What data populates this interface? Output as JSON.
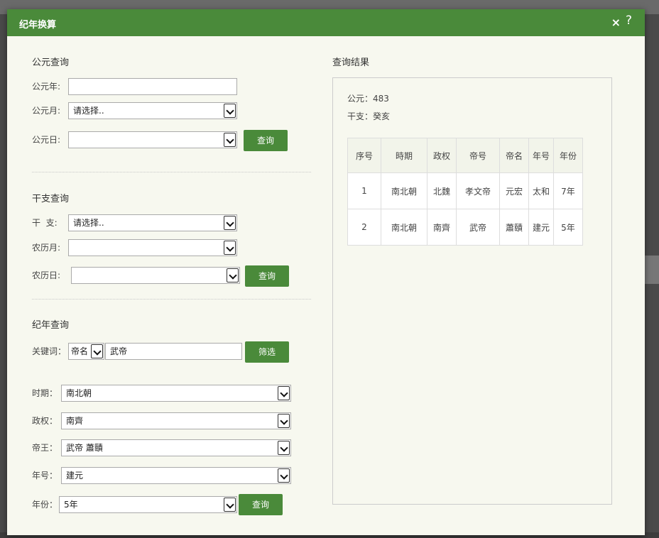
{
  "dialog": {
    "title": "纪年换算",
    "close_label": "×",
    "help_label": "?"
  },
  "ad_query": {
    "title": "公元查询",
    "year_label": "公元年:",
    "year_value": "",
    "month_label": "公元月:",
    "month_value": "请选择..",
    "day_label": "公元日:",
    "day_value": "",
    "submit_label": "查询"
  },
  "ganzhi_query": {
    "title": "干支查询",
    "ganzhi_label": "干  支:",
    "ganzhi_value": "请选择..",
    "lunar_month_label": "农历月:",
    "lunar_month_value": "",
    "lunar_day_label": "农历日:",
    "lunar_day_value": "",
    "submit_label": "查询"
  },
  "era_query": {
    "title": "纪年查询",
    "keyword_label": "关键词：",
    "keyword_type": "帝名",
    "keyword_value": "武帝",
    "filter_label": "筛选",
    "period_label": "时期：",
    "period_value": "南北朝",
    "regime_label": "政权：",
    "regime_value": "南齊",
    "emperor_label": "帝王：",
    "emperor_value": "武帝 蕭賾",
    "era_name_label": "年号：",
    "era_name_value": "建元",
    "year_label": "年份：",
    "year_value": "5年",
    "submit_label": "查询"
  },
  "results": {
    "title": "查询结果",
    "ad_line": "公元：483",
    "ganzhi_line": "干支：癸亥",
    "columns": [
      "序号",
      "時期",
      "政权",
      "帝号",
      "帝名",
      "年号",
      "年份"
    ],
    "rows": [
      [
        "1",
        "南北朝",
        "北魏",
        "孝文帝",
        "元宏",
        "太和",
        "7年"
      ],
      [
        "2",
        "南北朝",
        "南齊",
        "武帝",
        "蕭賾",
        "建元",
        "5年"
      ]
    ]
  }
}
